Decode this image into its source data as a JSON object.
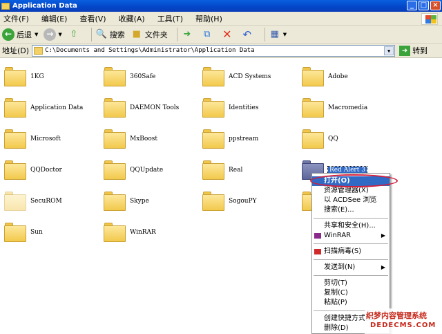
{
  "window": {
    "title": "Application Data"
  },
  "menu": [
    "文件(F)",
    "编辑(E)",
    "查看(V)",
    "收藏(A)",
    "工具(T)",
    "帮助(H)"
  ],
  "toolbar": {
    "back": "后退",
    "search": "搜索",
    "folders": "文件夹"
  },
  "address": {
    "label": "地址(D)",
    "path": "C:\\Documents and Settings\\Administrator\\Application Data",
    "go": "转到"
  },
  "folders": [
    "1KG",
    "360Safe",
    "ACD Systems",
    "Adobe",
    "Application Data",
    "DAEMON Tools",
    "Identities",
    "Macromedia",
    "Microsoft",
    "MxBoost",
    "ppstream",
    "QQ",
    "QQDoctor",
    "QQUpdate",
    "Real",
    "Red Alert 3",
    "SecuROM",
    "Skype",
    "SogouPY",
    "",
    "Sun",
    "WinRAR"
  ],
  "context_menu": {
    "open": "打开(O)",
    "explorer": "资源管理器(X)",
    "acdsee": "以 ACDSee 浏览",
    "search": "搜索(E)...",
    "share": "共享和安全(H)...",
    "winrar": "WinRAR",
    "scan": "扫描病毒(S)",
    "sendto": "发送到(N)",
    "cut": "剪切(T)",
    "copy": "复制(C)",
    "paste": "粘贴(P)",
    "shortcut": "创建快捷方式(S)",
    "delete": "删除(D)"
  },
  "watermark": {
    "line1": "织梦内容管理系统",
    "line2": "DEDECMS.COM"
  },
  "colors": {
    "selection": "#316ac5",
    "highlight_ring": "#d21f3c",
    "titlebar": "#0346c8"
  }
}
